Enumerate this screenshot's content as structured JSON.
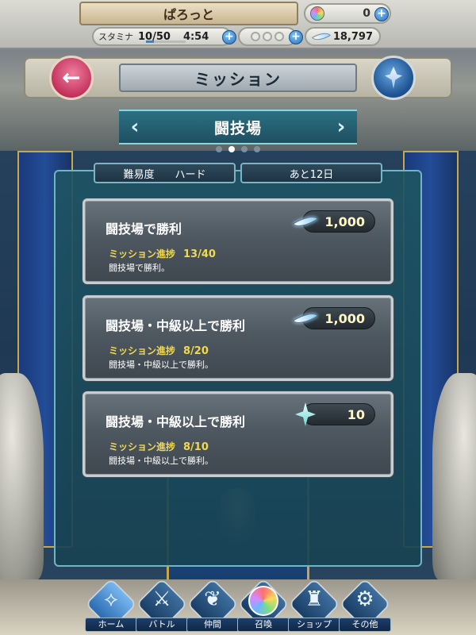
{
  "topbar": {
    "player_name": "ぱろっと",
    "orbs": "0",
    "stamina_label": "スタミナ",
    "stamina": "10/50",
    "stamina_fraction": 0.2,
    "stamina_timer": "4:54",
    "feathers": "18,797",
    "plus": "+"
  },
  "header": {
    "title": "ミッション",
    "back": "←"
  },
  "section": {
    "title": "闘技場",
    "prev": "‹",
    "next": "›",
    "page_count": 4,
    "active_page": 2
  },
  "info": {
    "difficulty_label": "難易度",
    "difficulty_value": "ハード",
    "remaining": "あと12日"
  },
  "missions": [
    {
      "title": "闘技場で勝利",
      "progress_label": "ミッション進捗",
      "progress": "13/40",
      "description": "闘技場で勝利。",
      "reward_icon": "feather-icon",
      "reward": "1,000"
    },
    {
      "title": "闘技場・中級以上で勝利",
      "progress_label": "ミッション進捗",
      "progress": "8/20",
      "description": "闘技場・中級以上で勝利。",
      "reward_icon": "feather-icon",
      "reward": "1,000"
    },
    {
      "title": "闘技場・中級以上で勝利",
      "progress_label": "ミッション進捗",
      "progress": "8/10",
      "description": "闘技場・中級以上で勝利。",
      "reward_icon": "crystal-icon",
      "reward": "10"
    }
  ],
  "nav": [
    {
      "label": "ホーム",
      "icon": "home-emblem-icon",
      "glyph": "⟡",
      "active": true
    },
    {
      "label": "バトル",
      "icon": "crossed-swords-icon",
      "glyph": "⚔"
    },
    {
      "label": "仲間",
      "icon": "wings-icon",
      "glyph": "❦"
    },
    {
      "label": "召喚",
      "icon": "orb-icon",
      "glyph": ""
    },
    {
      "label": "ショップ",
      "icon": "castle-icon",
      "glyph": "♜"
    },
    {
      "label": "その他",
      "icon": "gear-icon",
      "glyph": "⚙"
    }
  ],
  "colors": {
    "progress_text": "#f1da4f",
    "section_bar": "#2a7183",
    "back_button": "#c2305a",
    "panel": "#1e5464"
  }
}
